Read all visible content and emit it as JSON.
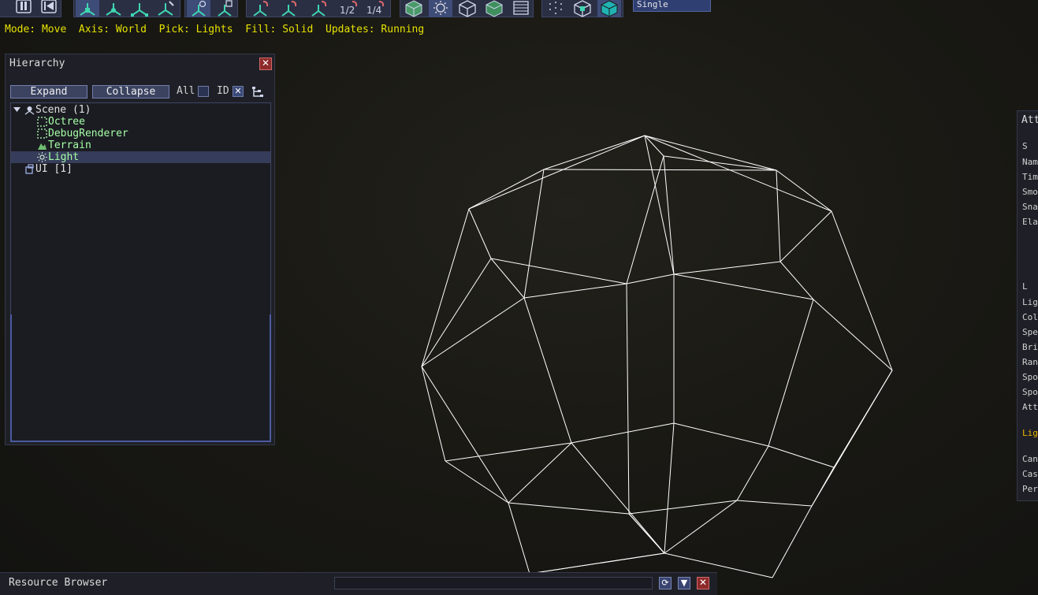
{
  "toolbar": {
    "groups": [
      {
        "name": "playback",
        "buttons": [
          "pause-icon",
          "rewind-icon"
        ]
      },
      {
        "name": "transform",
        "buttons": [
          "move-gizmo-icon",
          "rotate-gizmo-icon",
          "scale-gizmo-icon",
          "select-gizmo-icon"
        ]
      },
      {
        "name": "space",
        "buttons": [
          "local-axis-icon",
          "world-axis-icon"
        ]
      },
      {
        "name": "snap",
        "buttons": [
          "snap-icon",
          "snap-rotate-icon",
          "snap-scale-icon",
          "snap-half-icon",
          "snap-quarter-icon"
        ]
      },
      {
        "name": "render",
        "buttons": [
          "geometry-pick-icon",
          "light-pick-icon",
          "zone-pick-icon",
          "rigidbody-pick-icon",
          "ui-pick-icon"
        ]
      },
      {
        "name": "fill",
        "buttons": [
          "fill-points-icon",
          "fill-wireframe-icon",
          "fill-solid-icon"
        ]
      }
    ],
    "snap_half_label": "1/2",
    "snap_quarter_label": "1/4",
    "view_mode_select": "Single"
  },
  "status": {
    "text": "Mode: Move  Axis: World  Pick: Lights  Fill: Solid  Updates: Running"
  },
  "hierarchy": {
    "title": "Hierarchy",
    "expand_label": "Expand",
    "collapse_label": "Collapse",
    "all_label": "All",
    "all_checked": false,
    "id_label": "ID",
    "id_checked": true,
    "nodes": [
      {
        "label": "Scene (1)",
        "icon": "scene-icon",
        "expanded": true,
        "selected": false,
        "color": "#e0e0e0"
      },
      {
        "label": "Octree",
        "icon": "octree-icon",
        "selected": false,
        "color": "#a6ffa6"
      },
      {
        "label": "DebugRenderer",
        "icon": "debug-renderer-icon",
        "selected": false,
        "color": "#a6ffa6"
      },
      {
        "label": "Terrain",
        "icon": "terrain-icon",
        "selected": false,
        "color": "#a6ffa6"
      },
      {
        "label": "Light",
        "icon": "light-icon",
        "selected": true,
        "color": "#a6ffa6"
      },
      {
        "label": "UI [1]",
        "icon": "ui-root-icon",
        "selected": false,
        "color": "#e0e0e0"
      }
    ]
  },
  "attribute_inspector": {
    "title": "Att",
    "rows": [
      "S",
      "Nam",
      "Tim",
      "Smo",
      "Sna",
      "Ela",
      "",
      "",
      "L",
      "Lig",
      "Col",
      "Spe",
      "Bri",
      "Ran",
      "Spo",
      "Spo",
      "Att",
      "",
      "Lig",
      "",
      "Can",
      "Cas",
      "Per"
    ]
  },
  "resource_browser": {
    "title": "Resource Browser",
    "search_value": ""
  },
  "colors": {
    "status_text": "#e6e200",
    "tree_component": "#a6ffa6",
    "wireframe": "#ffffff",
    "panel_bg": "#1f2027",
    "accent": "#4b5aa0"
  }
}
